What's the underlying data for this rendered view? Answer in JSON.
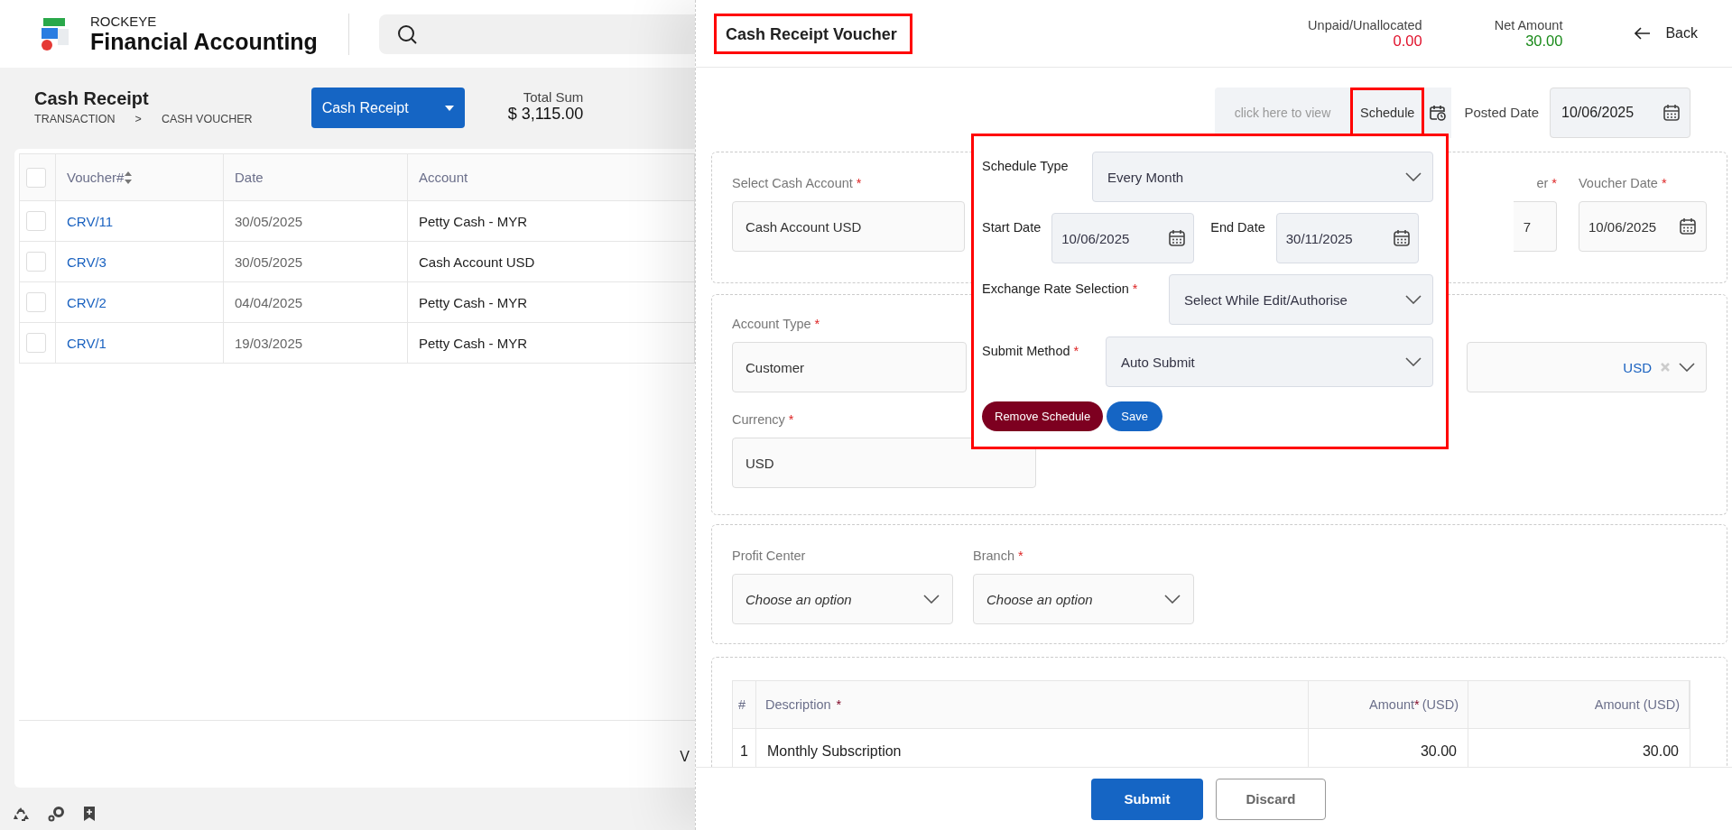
{
  "app": {
    "brand": "ROCKEYE",
    "product": "Financial Accounting"
  },
  "required_mark": "*",
  "page": {
    "title": "Cash Receipt",
    "breadcrumb": [
      "TRANSACTION",
      ">",
      "CASH VOUCHER"
    ],
    "action_button": "Cash Receipt",
    "total_label": "Total Sum",
    "total_value": "$ 3,115.00"
  },
  "list": {
    "all_checked": false,
    "columns": [
      {
        "label": "Voucher#",
        "sortable": true
      },
      {
        "label": "Date",
        "sortable": false
      },
      {
        "label": "Account",
        "sortable": false
      }
    ],
    "rows": [
      {
        "voucher": "CRV/11",
        "date": "30/05/2025",
        "account": "Petty Cash - MYR",
        "checked": false
      },
      {
        "voucher": "CRV/3",
        "date": "30/05/2025",
        "account": "Cash Account USD",
        "checked": false
      },
      {
        "voucher": "CRV/2",
        "date": "04/04/2025",
        "account": "Petty Cash - MYR",
        "checked": false
      },
      {
        "voucher": "CRV/1",
        "date": "19/03/2025",
        "account": "Petty Cash - MYR",
        "checked": false
      }
    ],
    "footer_text": "V"
  },
  "voucher": {
    "title": "Cash Receipt Voucher",
    "title_highlighted": true,
    "unpaid_label": "Unpaid/Unallocated",
    "unpaid_value": "0.00",
    "net_label": "Net Amount",
    "net_value": "30.00",
    "back": "Back",
    "schedule_hint": "click here to view",
    "schedule_button": "Schedule",
    "schedule_highlighted": true,
    "posted_date_label": "Posted Date",
    "posted_date": "10/06/2025",
    "cash_account": {
      "label": "Select Cash Account",
      "required": true,
      "value": "Cash Account USD"
    },
    "voucher_number": {
      "label": "er",
      "required": true,
      "value": "7"
    },
    "voucher_date": {
      "label": "Voucher Date",
      "required": true,
      "value": "10/06/2025"
    },
    "account_type": {
      "label": "Account Type",
      "required": true,
      "value": "Customer"
    },
    "account_currency": "USD",
    "currency": {
      "label": "Currency",
      "required": true,
      "value": "USD"
    },
    "profit_center": {
      "label": "Profit Center",
      "required": false,
      "placeholder": "Choose an option"
    },
    "branch": {
      "label": "Branch",
      "required": true,
      "placeholder": "Choose an option"
    },
    "lines": {
      "columns": [
        {
          "label": "#",
          "required": false
        },
        {
          "label": "Description",
          "required": true
        },
        {
          "label": "Amount",
          "required": true,
          "suffix": "(USD)"
        },
        {
          "label": "Amount (USD)",
          "required": false
        }
      ],
      "rows": [
        {
          "no": "1",
          "description": "Monthly Subscription",
          "amount": "30.00",
          "amount_base": "30.00"
        }
      ]
    },
    "submit": "Submit",
    "discard": "Discard"
  },
  "schedule_popup": {
    "highlighted": true,
    "schedule_type": {
      "label": "Schedule Type",
      "required": false,
      "value": "Every Month"
    },
    "start_date": {
      "label": "Start Date",
      "required": false,
      "value": "10/06/2025"
    },
    "end_date": {
      "label": "End Date",
      "required": false,
      "value": "30/11/2025"
    },
    "exchange_rate": {
      "label": "Exchange Rate Selection",
      "required": true,
      "value": "Select While Edit/Authorise"
    },
    "submit_method": {
      "label": "Submit Method",
      "required": true,
      "value": "Auto Submit"
    },
    "remove_button": "Remove Schedule",
    "save_button": "Save"
  }
}
